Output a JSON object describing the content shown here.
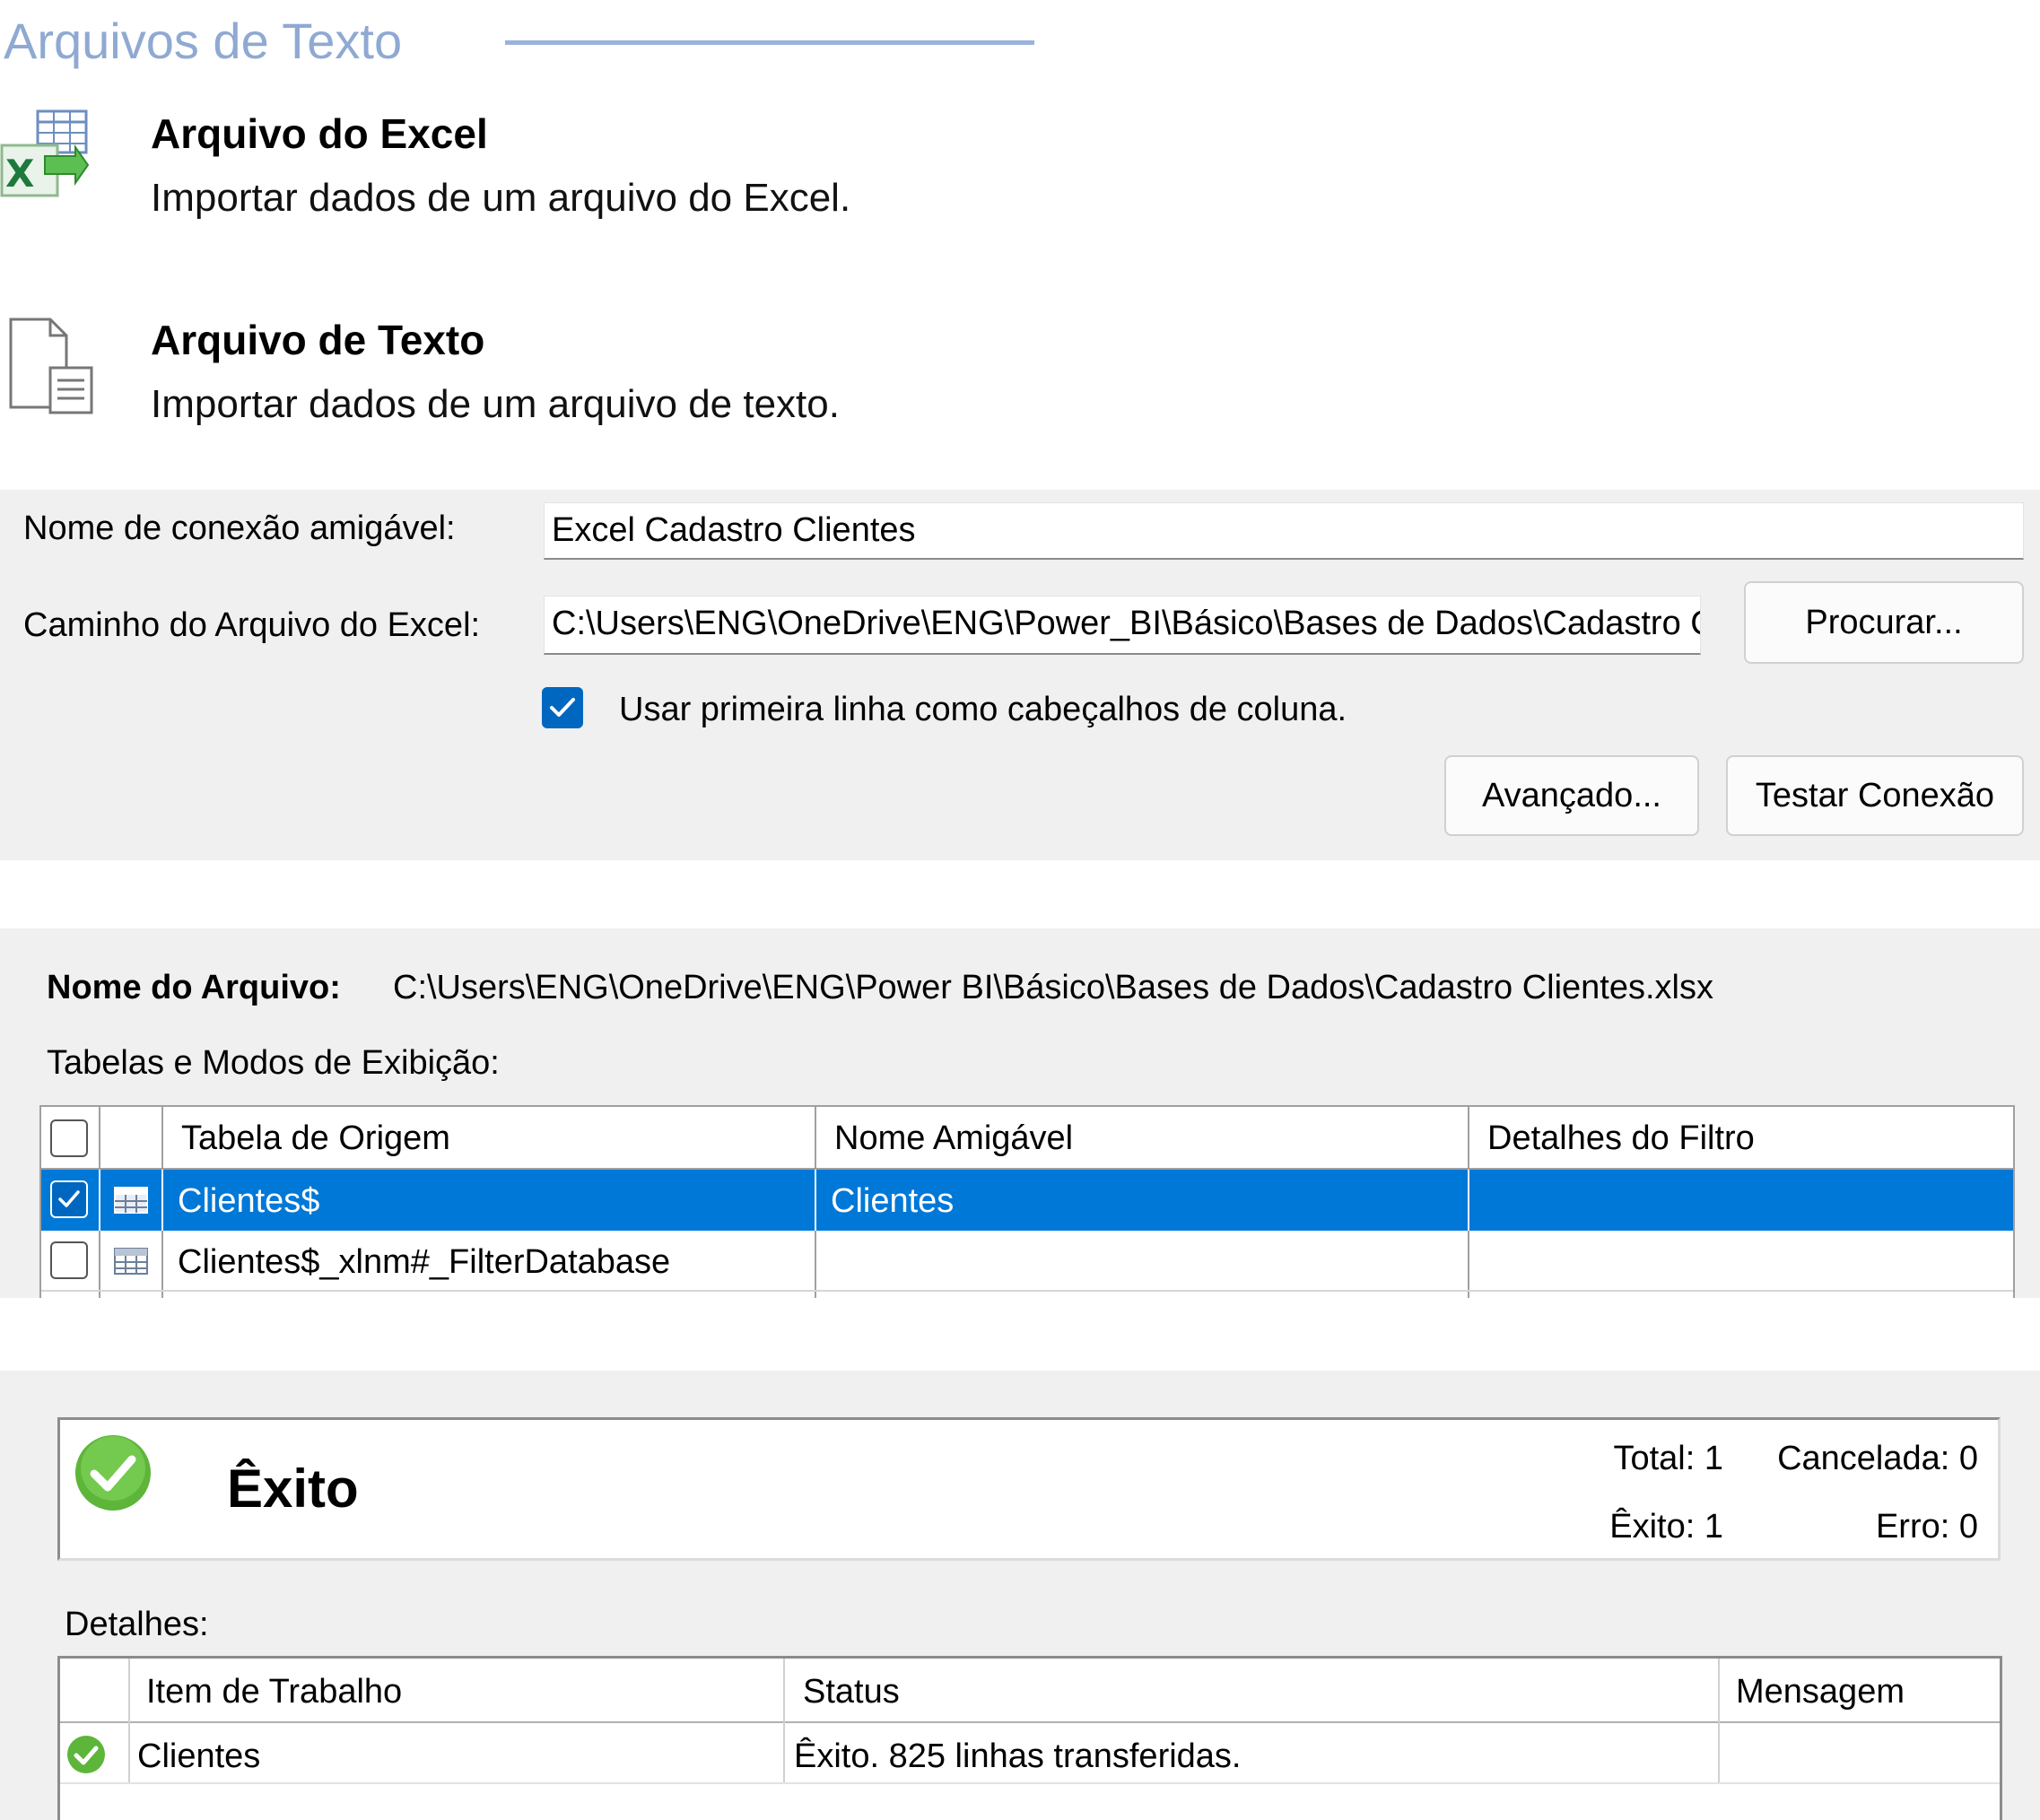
{
  "section": {
    "title": "Arquivos de Texto"
  },
  "sources": [
    {
      "title": "Arquivo do Excel",
      "description": "Importar dados de um arquivo do Excel.",
      "icon": "excel-file-icon"
    },
    {
      "title": "Arquivo de Texto",
      "description": "Importar dados de um arquivo de texto.",
      "icon": "text-file-icon"
    }
  ],
  "connection": {
    "friendly_name_label": "Nome de conexão amigável:",
    "friendly_name_value": "Excel Cadastro Clientes",
    "path_label": "Caminho do Arquivo do Excel:",
    "path_value": "C:\\Users\\ENG\\OneDrive\\ENG\\Power_BI\\Básico\\Bases de Dados\\Cadastro Clientes.xlsx",
    "browse_label": "Procurar...",
    "header_checkbox_label": "Usar primeira linha como cabeçalhos de coluna.",
    "header_checkbox_checked": true,
    "advanced_label": "Avançado...",
    "test_label": "Testar Conexão"
  },
  "tables": {
    "file_name_label": "Nome do Arquivo:",
    "file_name_value": "C:\\Users\\ENG\\OneDrive\\ENG\\Power  BI\\Básico\\Bases de Dados\\Cadastro Clientes.xlsx",
    "list_label": "Tabelas e Modos de Exibição:",
    "columns": [
      "Tabela de Origem",
      "Nome Amigável",
      "Detalhes do Filtro"
    ],
    "rows": [
      {
        "checked": true,
        "selected": true,
        "source": "Clientes$",
        "friendly": "Clientes",
        "filter": ""
      },
      {
        "checked": false,
        "selected": false,
        "source": "Clientes$_xlnm#_FilterDatabase",
        "friendly": "",
        "filter": ""
      }
    ]
  },
  "result": {
    "status_title": "Êxito",
    "total_label": "Total: 1",
    "cancelled_label": "Cancelada: 0",
    "success_label": "Êxito: 1",
    "error_label": "Erro: 0",
    "details_label": "Detalhes:",
    "columns": [
      "Item de Trabalho",
      "Status",
      "Mensagem"
    ],
    "rows": [
      {
        "item": "Clientes",
        "status": "Êxito. 825 linhas transferidas.",
        "message": ""
      }
    ]
  },
  "colors": {
    "accent": "#0067c0",
    "success": "#5db53a",
    "section_title": "#8fa9d2"
  }
}
